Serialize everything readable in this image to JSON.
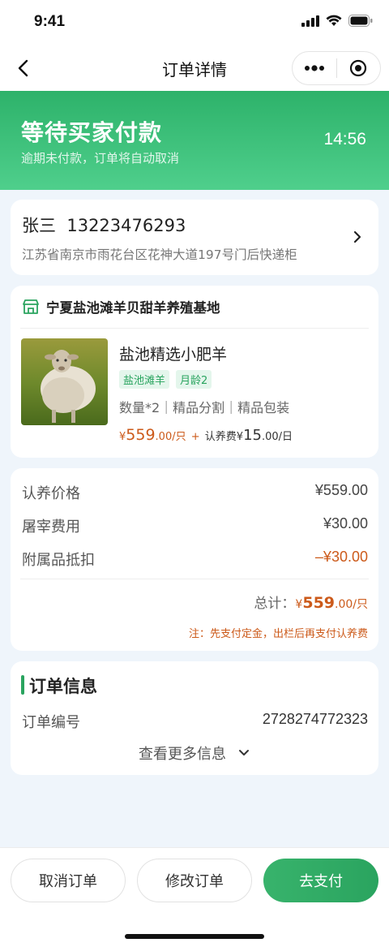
{
  "status_bar": {
    "time": "9:41"
  },
  "nav": {
    "title": "订单详情"
  },
  "banner": {
    "title": "等待买家付款",
    "subtitle": "逾期未付款，订单将自动取消",
    "countdown": "14:56"
  },
  "address": {
    "name_phone": "张三  13223476293",
    "detail": "江苏省南京市雨花台区花神大道197号门后快递柜"
  },
  "shop": {
    "name": "宁夏盐池滩羊贝甜羊养殖基地"
  },
  "product": {
    "title": "盐池精选小肥羊",
    "tags": [
      "盐池滩羊",
      "月龄2"
    ],
    "spec": "数量*2｜精品分割｜精品包装",
    "price_symbol": "¥",
    "price_int": "559",
    "price_rest": ".00/只",
    "plus": "+",
    "fee_label": "认养费¥",
    "fee_int": "15",
    "fee_rest": ".00/日"
  },
  "summary": {
    "rows": [
      {
        "label": "认养价格",
        "value": "¥559.00"
      },
      {
        "label": "屠宰费用",
        "value": "¥30.00"
      },
      {
        "label": "附属品抵扣",
        "value": "–¥30.00"
      }
    ],
    "total_label": "总计：",
    "total_symbol": "¥",
    "total_int": "559",
    "total_rest": ".00/只",
    "note": "注：先支付定金，出栏后再支付认养费"
  },
  "order_info": {
    "title": "订单信息",
    "number_label": "订单编号",
    "number_value": "2728274772323",
    "more_label": "查看更多信息"
  },
  "actions": {
    "cancel": "取消订单",
    "modify": "修改订单",
    "pay": "去支付"
  },
  "colors": {
    "accent_green": "#2aa45f",
    "price_orange": "#cc5a1a"
  }
}
